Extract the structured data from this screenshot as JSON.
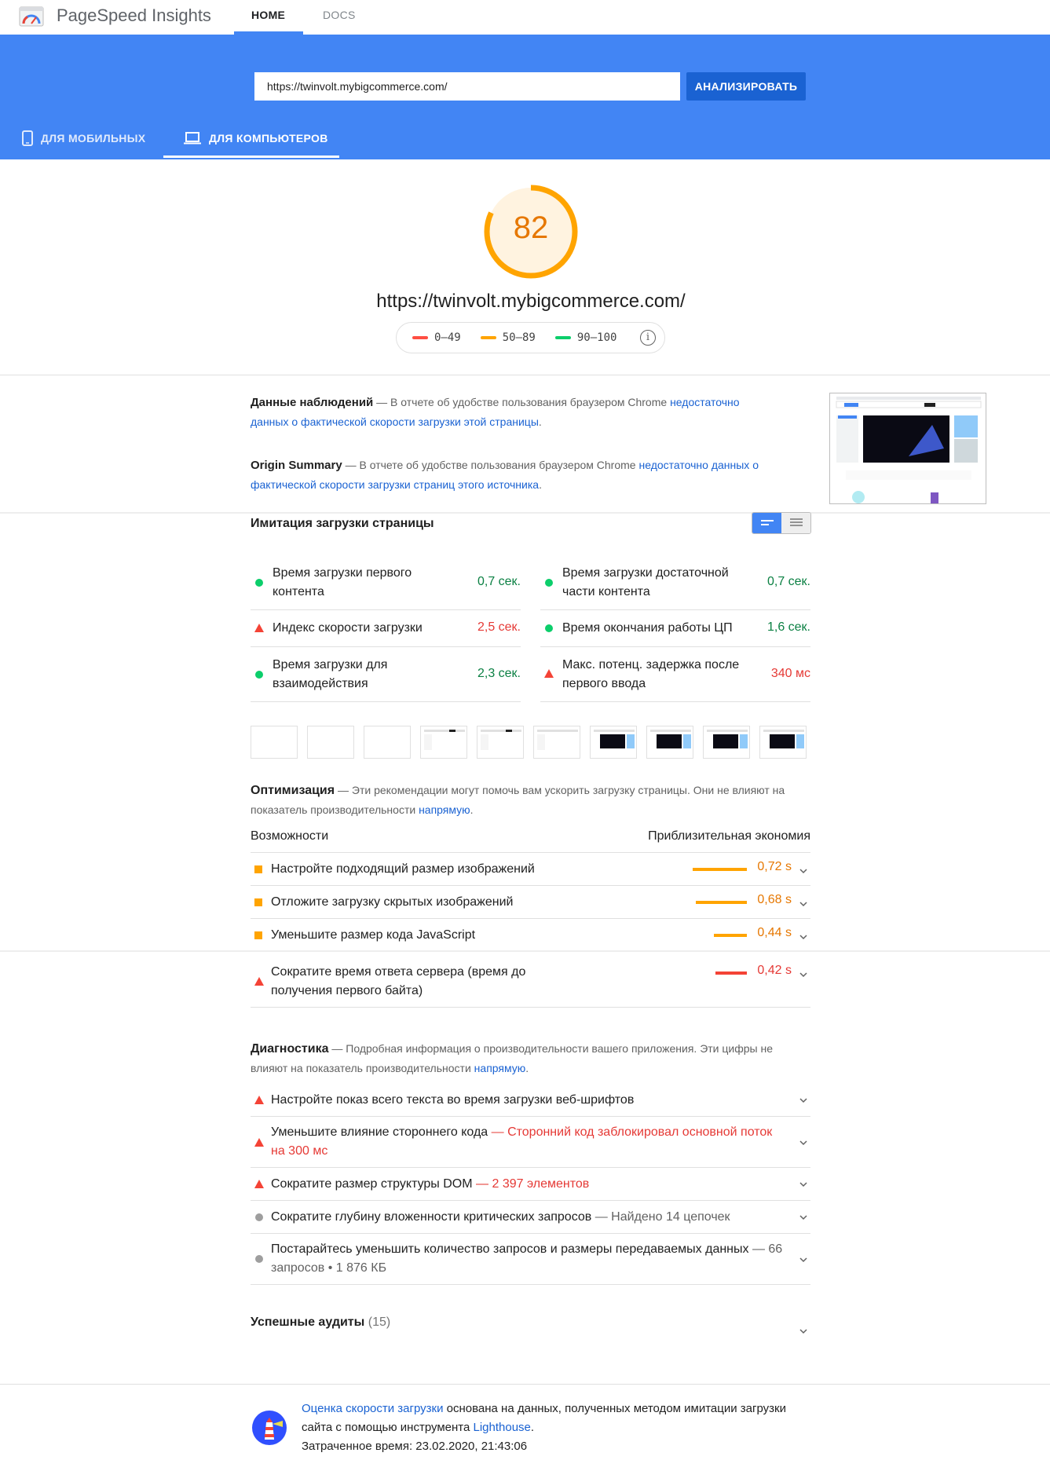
{
  "app": {
    "title": "PageSpeed Insights",
    "nav": {
      "home": "HOME",
      "docs": "DOCS"
    }
  },
  "header": {
    "url_value": "https://twinvolt.mybigcommerce.com/",
    "analyze_label": "АНАЛИЗИРОВАТЬ",
    "tabs": {
      "mobile": "ДЛЯ МОБИЛЬНЫХ",
      "desktop": "ДЛЯ КОМПЬЮТЕРОВ"
    },
    "active_tab": "desktop"
  },
  "score": {
    "value": "82",
    "fraction": 0.82,
    "url": "https://twinvolt.mybigcommerce.com/",
    "legend": {
      "bad": "0–49",
      "avg": "50–89",
      "good": "90–100"
    }
  },
  "field": {
    "title": "Данные наблюдений",
    "text": " — В отчете об удобстве пользования браузером Chrome ",
    "link": "недостаточно данных о фактической скорости загрузки этой страницы",
    "end": "."
  },
  "origin": {
    "title": "Origin Summary",
    "text": " — В отчете об удобстве пользования браузером Chrome ",
    "link": "недостаточно данных о фактической скорости загрузки страниц этого источника",
    "end": "."
  },
  "lab": {
    "title": "Имитация загрузки страницы",
    "metrics": [
      {
        "name": "Время загрузки первого контента",
        "value": "0,7 сек.",
        "status": "good"
      },
      {
        "name": "Время загрузки достаточной части контента",
        "value": "0,7 сек.",
        "status": "good"
      },
      {
        "name": "Индекс скорости загрузки",
        "value": "2,5 сек.",
        "status": "bad"
      },
      {
        "name": "Время окончания работы ЦП",
        "value": "1,6 сек.",
        "status": "good"
      },
      {
        "name": "Время загрузки для взаимодействия",
        "value": "2,3 сек.",
        "status": "good"
      },
      {
        "name": "Макс. потенц. задержка после первого ввода",
        "value": "340 мс",
        "status": "bad"
      }
    ]
  },
  "optimization": {
    "title": "Оптимизация",
    "text": " — Эти рекомендации могут помочь вам ускорить загрузку страницы. Они не влияют на показатель производительности ",
    "link": "напрямую",
    "end": ".",
    "col_left": "Возможности",
    "col_right": "Приблизительная экономия",
    "items": [
      {
        "name": "Настройте подходящий размер изображений",
        "value": "0,72 s",
        "bar": 0.72,
        "status": "avg"
      },
      {
        "name": "Отложите загрузку скрытых изображений",
        "value": "0,68 s",
        "bar": 0.68,
        "status": "avg"
      },
      {
        "name": "Уменьшите размер кода JavaScript",
        "value": "0,44 s",
        "bar": 0.44,
        "status": "avg"
      },
      {
        "name": "Сократите время ответа сервера (время до получения первого байта)",
        "value": "0,42 s",
        "bar": 0.42,
        "status": "bad"
      }
    ]
  },
  "diagnostics": {
    "title": "Диагностика",
    "text": " — Подробная информация о производительности вашего приложения. Эти цифры не влияют на показатель производительности ",
    "link": "напрямую",
    "end": ".",
    "items": [
      {
        "name": "Настройте показ всего текста во время загрузки веб-шрифтов",
        "detail": "",
        "status": "bad"
      },
      {
        "name": "Уменьшите влияние стороннего кода",
        "detail": " — Сторонний код заблокировал основной поток на 300 мс",
        "status": "bad"
      },
      {
        "name": "Сократите размер структуры DOM",
        "detail": " — 2 397 элементов",
        "status": "bad"
      },
      {
        "name": "Сократите глубину вложенности критических запросов",
        "detail": " — Найдено 14 цепочек",
        "status": "info"
      },
      {
        "name": "Постарайтесь уменьшить количество запросов и размеры передаваемых данных",
        "detail": " — 66 запросов • 1 876 КБ",
        "status": "info"
      }
    ]
  },
  "passed": {
    "label": "Успешные аудиты",
    "count": "(15)"
  },
  "footer": {
    "link1": "Оценка скорости загрузки",
    "text1": " основана на данных, полученных методом имитации загрузки сайта с помощью инструмента ",
    "link2": "Lighthouse",
    "text2": ".",
    "time": "Затраченное время: 23.02.2020, 21:43:06"
  },
  "colors": {
    "brand": "#4285f4",
    "good": "#0cce6b",
    "avg": "#ffa400",
    "bad": "#ff4e42"
  }
}
